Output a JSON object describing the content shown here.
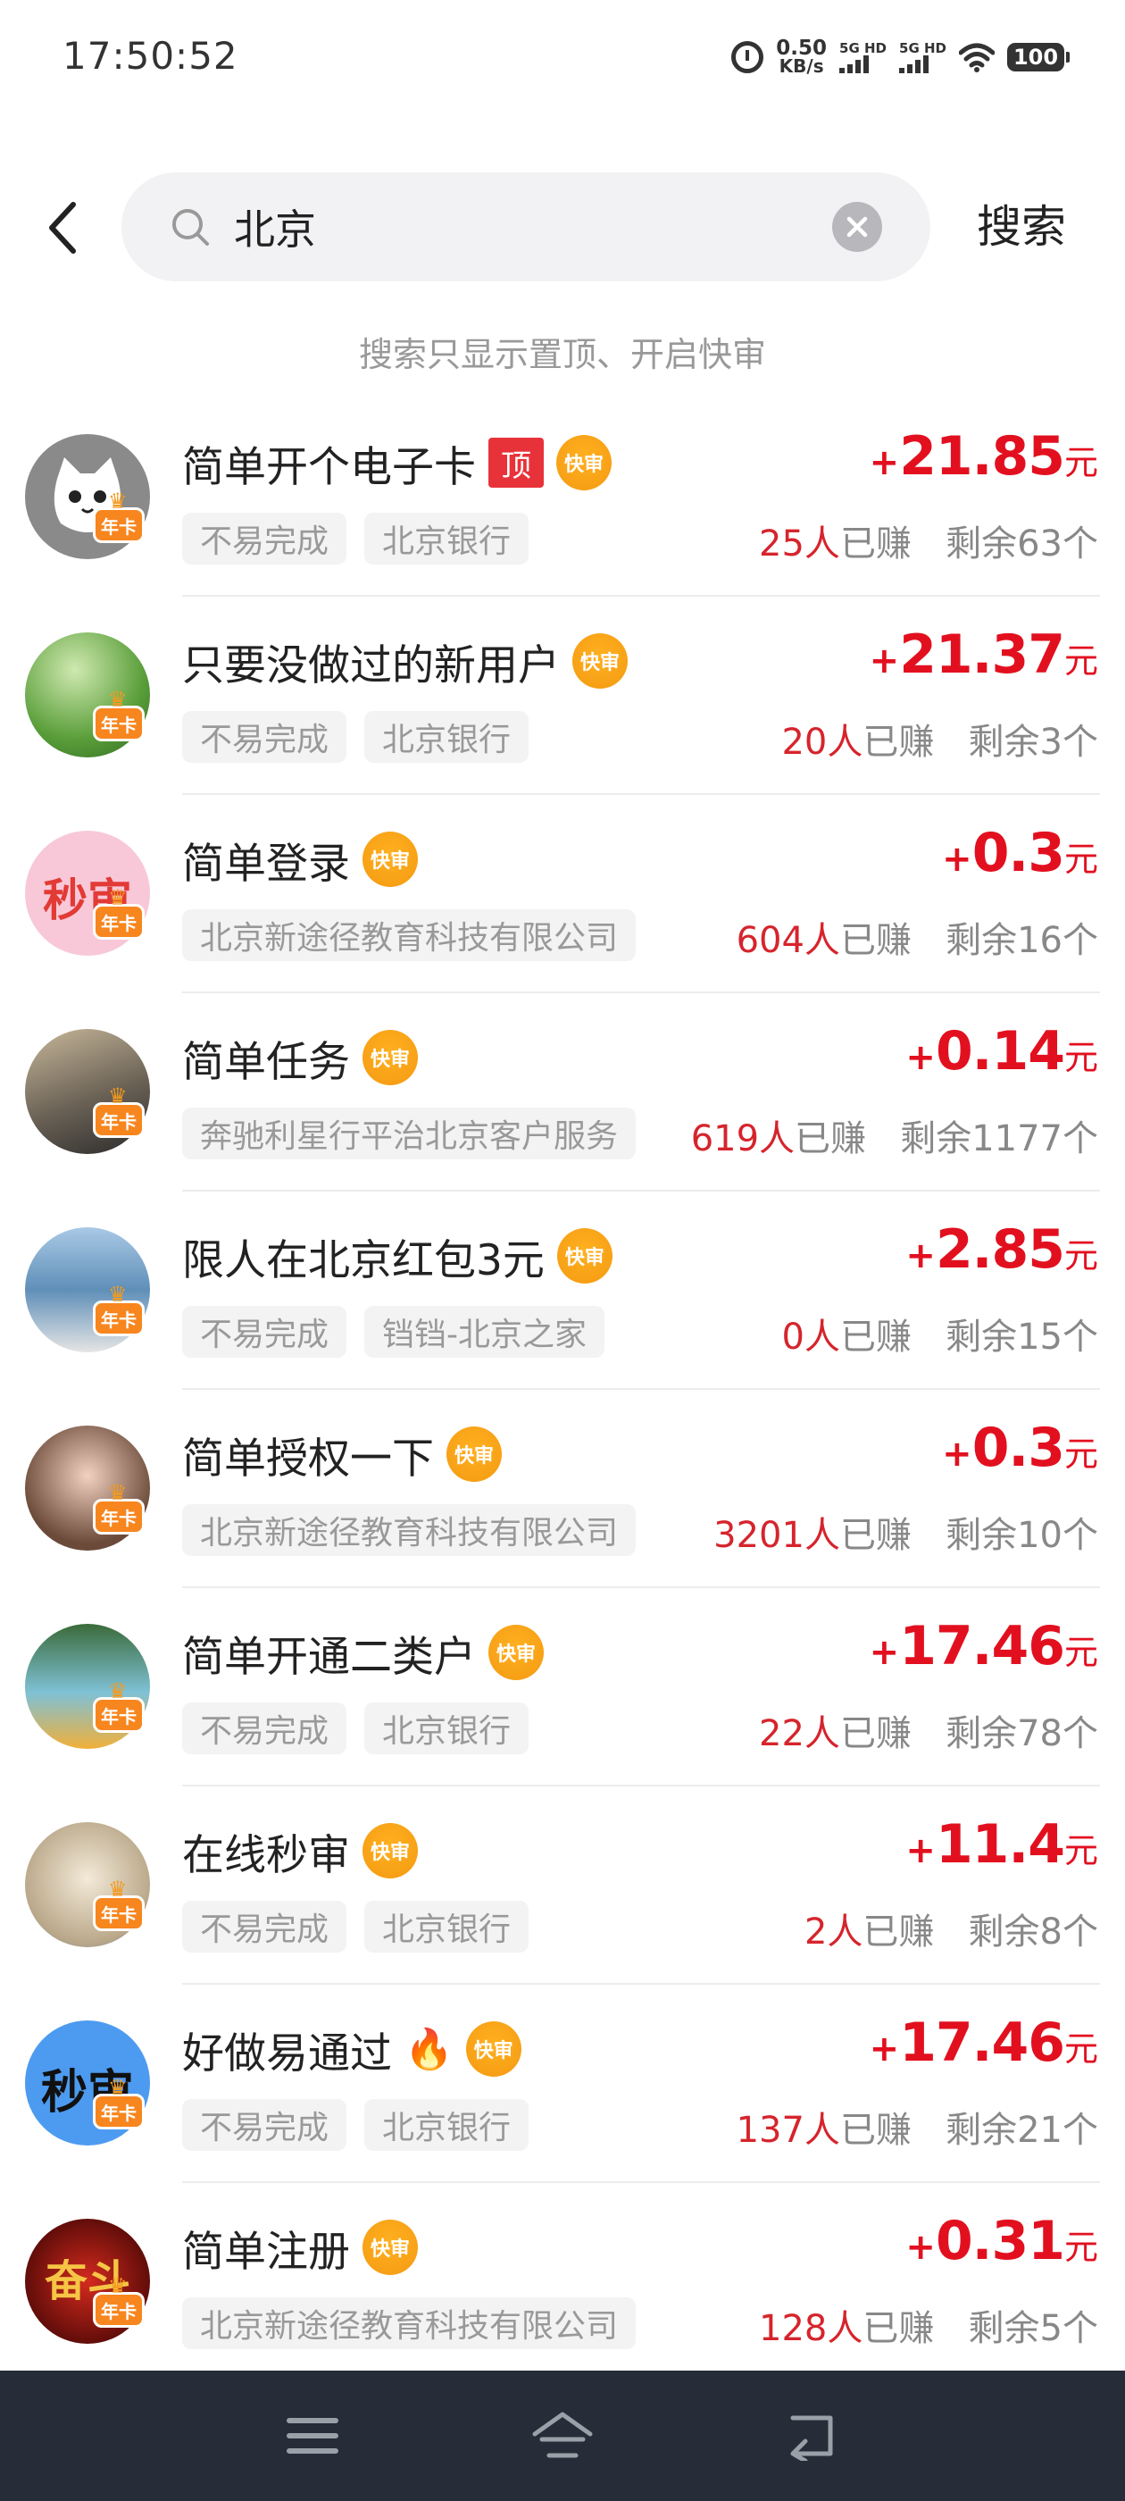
{
  "status_bar": {
    "time": "17:50:52",
    "net_speed_value": "0.50",
    "net_speed_unit": "KB/s",
    "sim1_label": "5G HD",
    "sim2_label": "5G HD",
    "battery": "100",
    "icons": [
      "alarm-icon",
      "signal-icon",
      "wifi-icon",
      "battery-icon"
    ]
  },
  "search": {
    "query": "北京",
    "placeholder": "",
    "submit_label": "搜索"
  },
  "hint": "搜索只显示置顶、开启快审",
  "tags": {
    "top": "顶",
    "fast": "快审",
    "annual_card": "年卡"
  },
  "labels": {
    "earned_suffix": "已赚",
    "remaining_prefix": "剩余",
    "remaining_suffix": "个",
    "currency": "元",
    "plus": "+"
  },
  "colors": {
    "accent_red": "#e2101f",
    "fast_badge": "#f49a12",
    "top_badge": "#e8323a",
    "nav_bar": "#262d38"
  },
  "tasks": [
    {
      "title": "简单开个电子卡",
      "pinned": true,
      "emoji": "",
      "difficulty": "不易完成",
      "merchant": "北京银行",
      "amount": "21.85",
      "earned": "25人",
      "remaining": "63",
      "avatar": "cat-avatar"
    },
    {
      "title": "只要没做过的新用户",
      "pinned": false,
      "emoji": "",
      "difficulty": "",
      "merchant": "北京银行",
      "difficulty2": "不易完成",
      "amount": "21.37",
      "earned": "20人",
      "remaining": "3",
      "avatar": "grass-avatar"
    },
    {
      "title": "简单登录",
      "pinned": false,
      "emoji": "",
      "difficulty": "",
      "merchant": "北京新途径教育科技有限公司",
      "amount": "0.3",
      "earned": "604人",
      "remaining": "16",
      "avatar": "miaoshen-pink-avatar"
    },
    {
      "title": "简单任务",
      "pinned": false,
      "emoji": "",
      "difficulty": "",
      "merchant": "奔驰利星行平治北京客户服务",
      "amount": "0.14",
      "earned": "619人",
      "remaining": "1177",
      "avatar": "rider-avatar"
    },
    {
      "title": "限人在北京红包3元",
      "pinned": false,
      "emoji": "",
      "difficulty": "不易完成",
      "merchant": "铛铛-北京之家",
      "amount": "2.85",
      "earned": "0人",
      "remaining": "15",
      "avatar": "sea-avatar"
    },
    {
      "title": "简单授权一下",
      "pinned": false,
      "emoji": "",
      "difficulty": "",
      "merchant": "北京新途径教育科技有限公司",
      "amount": "0.3",
      "earned": "3201人",
      "remaining": "10",
      "avatar": "girl-avatar"
    },
    {
      "title": "简单开通二类户",
      "pinned": false,
      "emoji": "",
      "difficulty": "不易完成",
      "merchant": "北京银行",
      "amount": "17.46",
      "earned": "22人",
      "remaining": "78",
      "avatar": "cartoon-avatar"
    },
    {
      "title": "在线秒审",
      "pinned": false,
      "emoji": "",
      "difficulty": "不易完成",
      "merchant": "北京银行",
      "amount": "11.4",
      "earned": "2人",
      "remaining": "8",
      "avatar": "alpaca-avatar"
    },
    {
      "title": "好做易通过",
      "pinned": false,
      "emoji": "🔥",
      "difficulty": "不易完成",
      "merchant": "北京银行",
      "amount": "17.46",
      "earned": "137人",
      "remaining": "21",
      "avatar": "miaoshen-blue-avatar"
    },
    {
      "title": "简单注册",
      "pinned": false,
      "emoji": "",
      "difficulty": "",
      "merchant": "北京新途径教育科技有限公司",
      "amount": "0.31",
      "earned": "128人",
      "remaining": "5",
      "avatar": "fendou-avatar"
    }
  ],
  "avatar_texts": {
    "miaoshen": "秒审",
    "fendou": "奋斗"
  },
  "nav": [
    "menu-icon",
    "home-icon",
    "back-icon"
  ]
}
